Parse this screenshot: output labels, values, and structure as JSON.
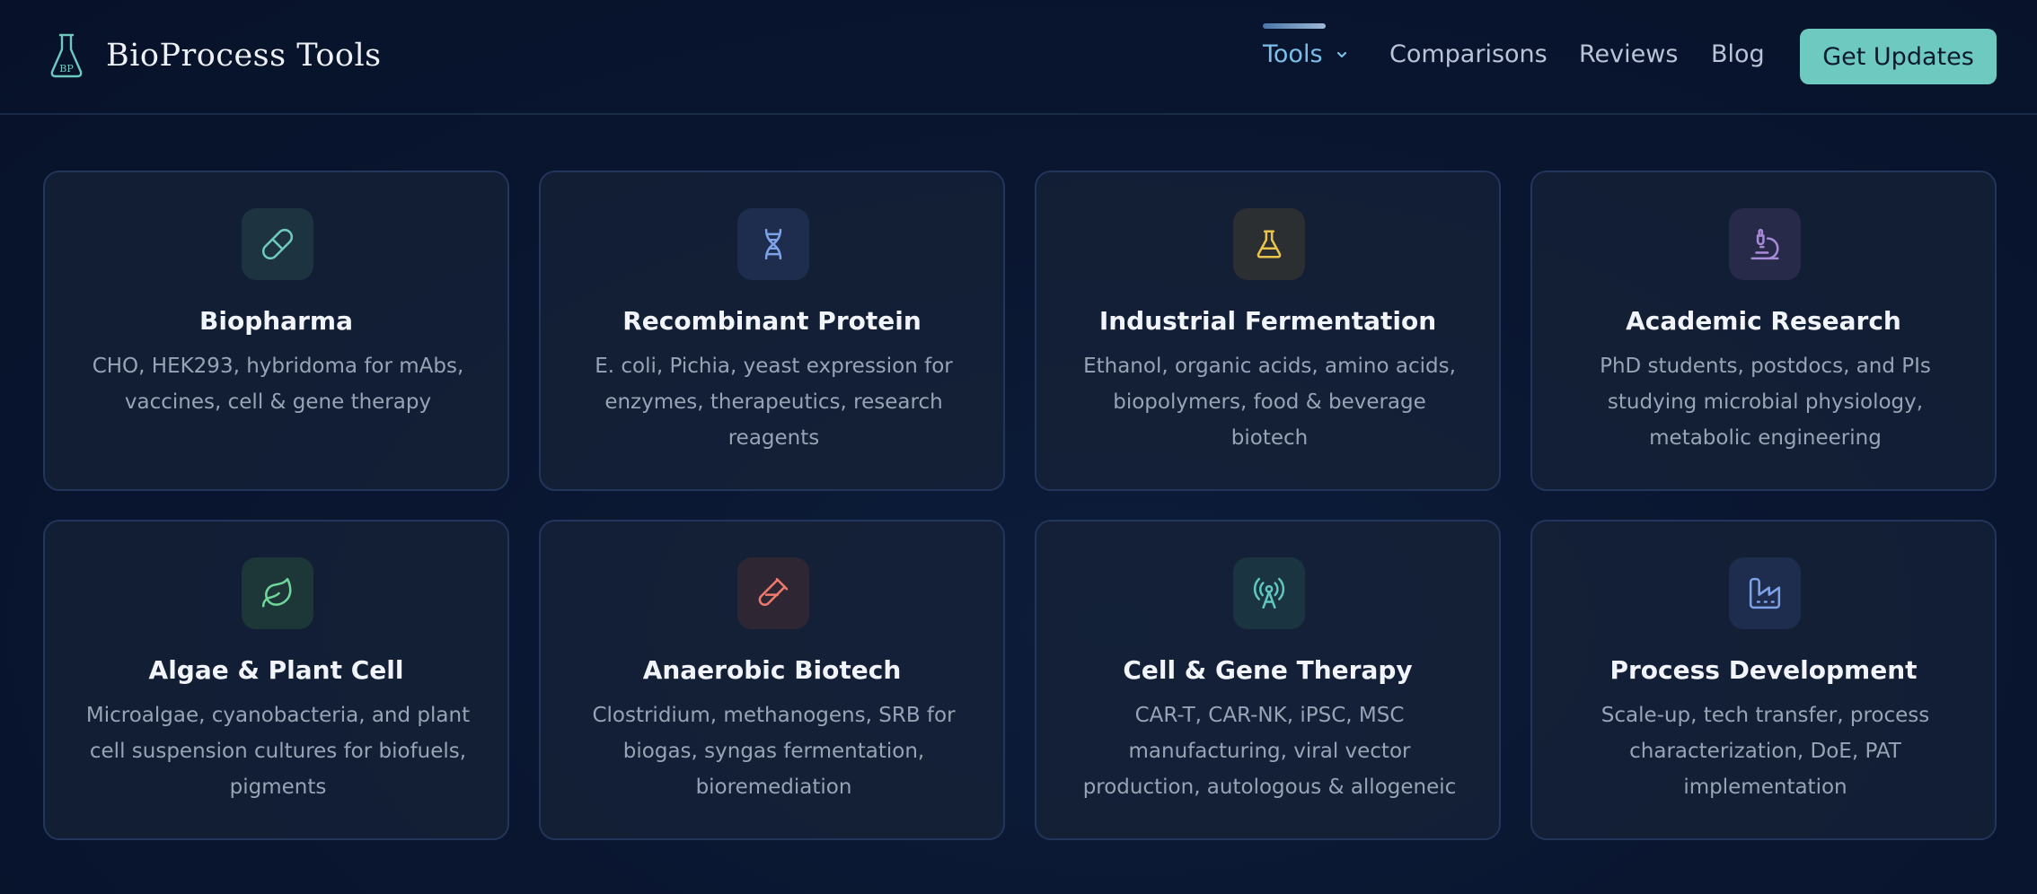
{
  "header": {
    "logo_text": "BioProcess Tools",
    "nav": {
      "tools": "Tools",
      "comparisons": "Comparisons",
      "reviews": "Reviews",
      "blog": "Blog"
    },
    "cta_label": "Get Updates"
  },
  "cards": [
    {
      "title": "Biopharma",
      "desc": "CHO, HEK293, hybridoma for mAbs, vaccines, cell & gene therapy",
      "icon": "pill-icon",
      "color": "#6ec9c1"
    },
    {
      "title": "Recombinant Protein",
      "desc": "E. coli, Pichia, yeast expression for enzymes, therapeutics, research reagents",
      "icon": "dna-icon",
      "color": "#7ea2e8"
    },
    {
      "title": "Industrial Fermentation",
      "desc": "Ethanol, organic acids, amino acids, biopolymers, food & beverage biotech",
      "icon": "flask-icon",
      "color": "#e8c44a"
    },
    {
      "title": "Academic Research",
      "desc": "PhD students, postdocs, and PIs studying microbial physiology, metabolic engineering",
      "icon": "microscope-icon",
      "color": "#a78bd8"
    },
    {
      "title": "Algae & Plant Cell",
      "desc": "Microalgae, cyanobacteria, and plant cell suspension cultures for biofuels, pigments",
      "icon": "leaf-icon",
      "color": "#6fd69a"
    },
    {
      "title": "Anaerobic Biotech",
      "desc": "Clostridium, methanogens, SRB for biogas, syngas fermentation, bioremediation",
      "icon": "test-tube-icon",
      "color": "#ee7a6c"
    },
    {
      "title": "Cell & Gene Therapy",
      "desc": "CAR-T, CAR-NK, iPSC, MSC manufacturing, viral vector production, autologous & allogeneic",
      "icon": "radio-tower-icon",
      "color": "#5fc6c0"
    },
    {
      "title": "Process Development",
      "desc": "Scale-up, tech transfer, process characterization, DoE, PAT implementation",
      "icon": "factory-icon",
      "color": "#7ea2e8"
    }
  ]
}
